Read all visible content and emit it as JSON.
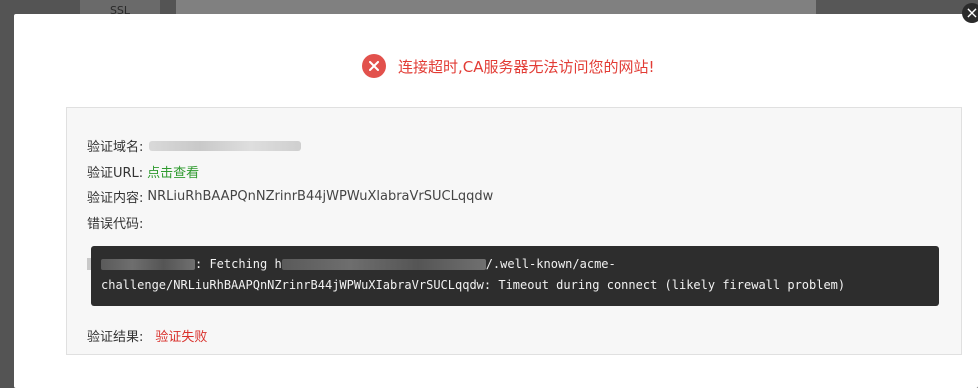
{
  "background": {
    "nav_item_label": "SSL",
    "close_glyph": "×"
  },
  "alert": {
    "icon": "close-circle-icon",
    "icon_glyph": "✕",
    "message": "连接超时,CA服务器无法访问您的网站!",
    "color": "#e2514c"
  },
  "details": {
    "domain_label": "验证域名:",
    "url_label": "验证URL:",
    "url_link": "点击查看",
    "content_label": "验证内容:",
    "content_value": "NRLiuRhBAAPQnNZrinrB44jWPWuXlabraVrSUCLqqdw",
    "error_label": "错误代码:",
    "result_label": "验证结果:",
    "result_value": "验证失败"
  },
  "console": {
    "fetching_prefix": ": Fetching h",
    "path_part1": "/.well-known/acme-",
    "line2": "challenge/NRLiuRhBAAPQnNZrinrB44jWPWuXIabraVrSUCLqqdw: Timeout during connect (likely firewall problem)"
  }
}
